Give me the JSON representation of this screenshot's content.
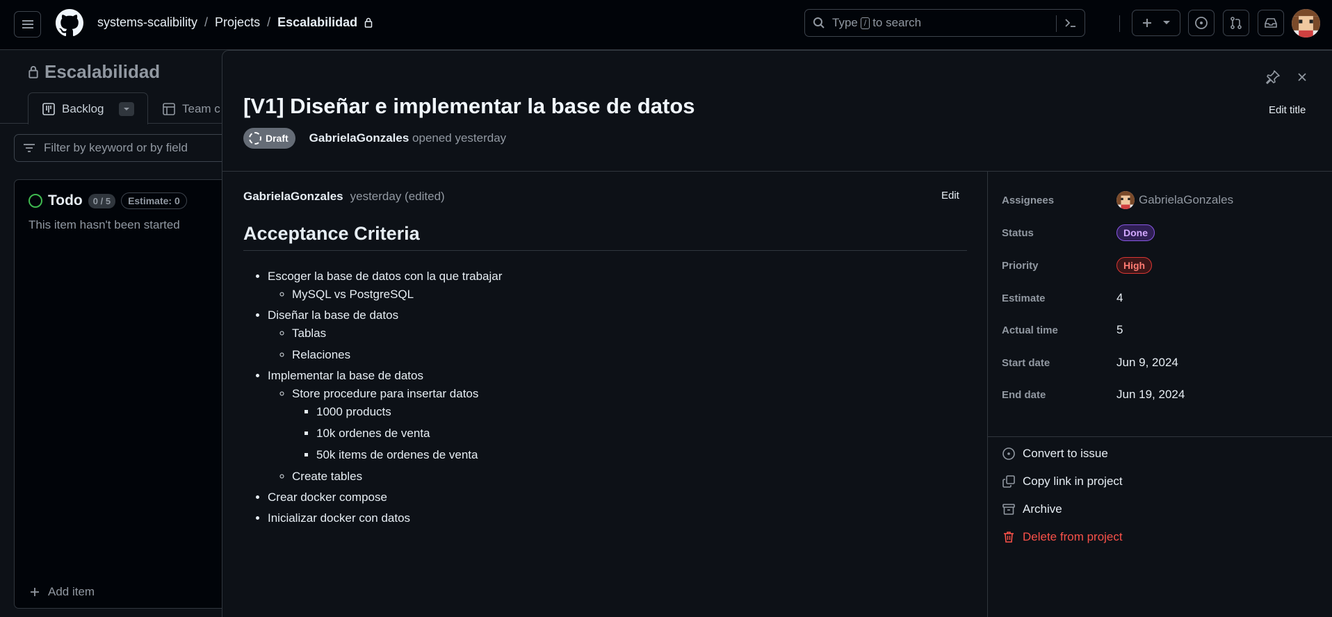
{
  "header": {
    "breadcrumb": {
      "owner": "systems-scalibility",
      "sep1": "/",
      "projects": "Projects",
      "sep2": "/",
      "current": "Escalabilidad"
    },
    "search": {
      "prefix": "Type",
      "key": "/",
      "suffix": "to search"
    }
  },
  "project": {
    "title": "Escalabilidad",
    "tabs": [
      {
        "label": "Backlog",
        "icon": "board-icon"
      },
      {
        "label": "Team c",
        "icon": "table-icon"
      }
    ],
    "filter_placeholder": "Filter by keyword or by field",
    "column": {
      "name": "Todo",
      "count": "0 / 5",
      "estimate": "Estimate: 0",
      "description": "This item hasn't been started",
      "add_item": "Add item"
    }
  },
  "item": {
    "title": "[V1] Diseñar e implementar la base de datos",
    "edit_title": "Edit title",
    "status_badge": "Draft",
    "author": "GabrielaGonzales",
    "opened": "opened yesterday",
    "body": {
      "author": "GabrielaGonzales",
      "when": "yesterday (edited)",
      "edit": "Edit",
      "heading": "Acceptance Criteria",
      "list": [
        {
          "text": "Escoger la base de datos con la que trabajar",
          "children": [
            "MySQL vs PostgreSQL"
          ]
        },
        {
          "text": "Diseñar la base de datos",
          "children": [
            "Tablas",
            "Relaciones"
          ]
        },
        {
          "text": "Implementar la base de datos",
          "children": [
            "Store procedure para insertar datos",
            "1000 products",
            "10k ordenes de venta",
            "50k items de ordenes de venta",
            "Create tables"
          ]
        },
        {
          "text": "Crear docker compose",
          "children": []
        },
        {
          "text": "Inicializar docker con datos",
          "children": []
        }
      ]
    },
    "fields": {
      "assignees": {
        "label": "Assignees",
        "value": "GabrielaGonzales"
      },
      "status": {
        "label": "Status",
        "value": "Done"
      },
      "priority": {
        "label": "Priority",
        "value": "High"
      },
      "estimate": {
        "label": "Estimate",
        "value": "4"
      },
      "actual_time": {
        "label": "Actual time",
        "value": "5"
      },
      "start_date": {
        "label": "Start date",
        "value": "Jun 9, 2024"
      },
      "end_date": {
        "label": "End date",
        "value": "Jun 19, 2024"
      }
    },
    "actions": {
      "convert": "Convert to issue",
      "copy_link": "Copy link in project",
      "archive": "Archive",
      "delete": "Delete from project"
    }
  },
  "colors": {
    "background": "#010409",
    "panel": "#0d1117",
    "border": "#30363d",
    "done": "#d2a8ff",
    "high": "#ff7b72",
    "danger": "#f85149",
    "open_green": "#3fb950"
  }
}
